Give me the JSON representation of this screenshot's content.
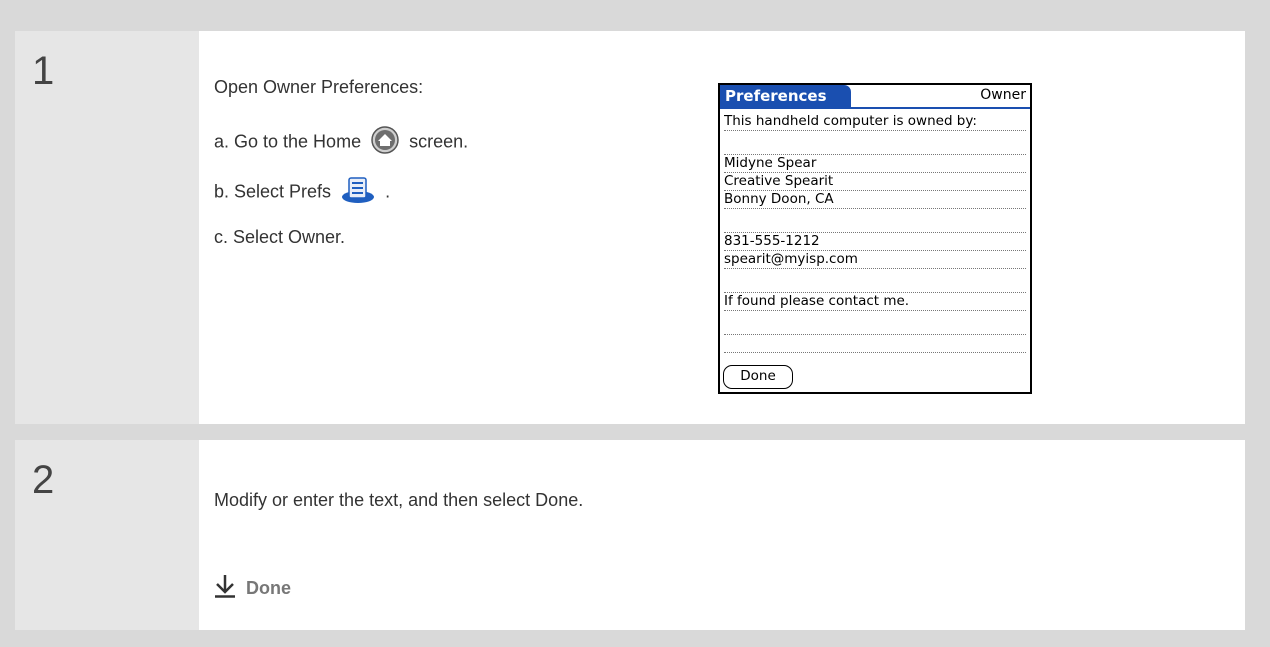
{
  "step1": {
    "number": "1",
    "intro": "Open Owner Preferences:",
    "a_prefix": "a. Go to the Home",
    "a_suffix": "screen.",
    "b_prefix": "b. Select Prefs",
    "b_suffix": ".",
    "c": "c. Select Owner.",
    "icons": {
      "home": "home-icon",
      "prefs": "prefs-icon"
    }
  },
  "palm": {
    "title": "Preferences",
    "category": "Owner",
    "lines": [
      "This handheld computer is owned by:",
      "",
      "Midyne Spear",
      "Creative Spearit",
      "Bonny Doon, CA",
      "",
      "831-555-1212",
      "spearit@myisp.com",
      "",
      "If found please contact me.",
      "",
      ""
    ],
    "done_button": "Done",
    "accent": "#1a4fb0"
  },
  "step2": {
    "number": "2",
    "text": "Modify or enter the text, and then select Done.",
    "done_label": "Done",
    "icon": "down-arrow-icon"
  }
}
